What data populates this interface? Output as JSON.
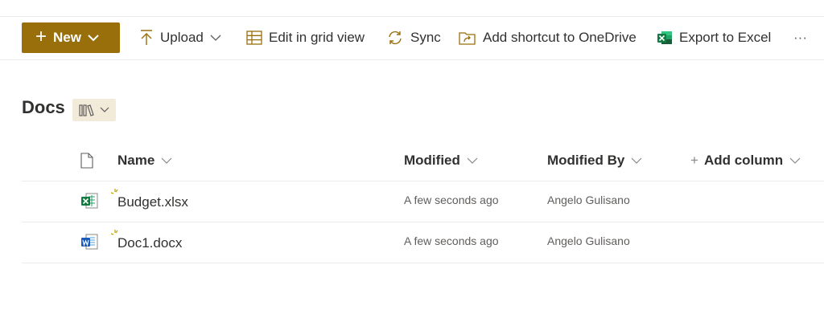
{
  "toolbar": {
    "new_label": "New",
    "upload_label": "Upload",
    "edit_grid_label": "Edit in grid view",
    "sync_label": "Sync",
    "add_shortcut_label": "Add shortcut to OneDrive",
    "export_label": "Export to Excel",
    "more_label": "···"
  },
  "library": {
    "title": "Docs"
  },
  "columns": {
    "name": "Name",
    "modified": "Modified",
    "modified_by": "Modified By",
    "add_column": "Add column"
  },
  "files": [
    {
      "name": "Budget.xlsx",
      "type": "excel",
      "icon": "excel-file-icon",
      "modified": "A few seconds ago",
      "modified_by": "Angelo Gulisano"
    },
    {
      "name": "Doc1.docx",
      "type": "word",
      "icon": "word-file-icon",
      "modified": "A few seconds ago",
      "modified_by": "Angelo Gulisano"
    }
  ],
  "colors": {
    "accent": "#986f0b",
    "view_bg": "#f3ebd9",
    "excel": "#107c41",
    "word": "#185abd",
    "spark": "#c19c00"
  }
}
